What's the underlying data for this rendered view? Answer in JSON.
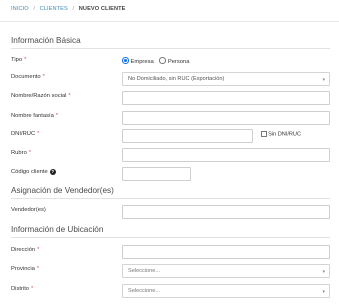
{
  "breadcrumb": {
    "items": [
      "INICIO",
      "CLIENTES"
    ],
    "separator": "/",
    "current": "NUEVO CLIENTE"
  },
  "sections": {
    "basic": "Información Básica",
    "seller": "Asignación de Vendedor(es)",
    "location": "Información de Ubicación"
  },
  "fields": {
    "tipo": {
      "label": "Tipo",
      "options": [
        "Empresa",
        "Persona"
      ],
      "selected": "Empresa"
    },
    "documento": {
      "label": "Documento",
      "value": "No Domiciliado, sin RUC (Exportación)"
    },
    "nombre_razon": {
      "label": "Nombre/Razón social",
      "value": ""
    },
    "nombre_fantasia": {
      "label": "Nombre fantasía",
      "value": ""
    },
    "dni_ruc": {
      "label": "DNI/RUC",
      "value": "",
      "checkbox_label": "Sin DNI/RUC"
    },
    "rubro": {
      "label": "Rubro",
      "value": ""
    },
    "codigo_cliente": {
      "label": "Código cliente",
      "value": ""
    },
    "vendedores": {
      "label": "Vendedor(es)",
      "value": ""
    },
    "direccion": {
      "label": "Dirección",
      "value": ""
    },
    "provincia": {
      "label": "Provincia",
      "value": "Seleccione..."
    },
    "distrito": {
      "label": "Distrito",
      "value": "Seleccione..."
    }
  },
  "required_marker": "*",
  "icons": {
    "help": "question-circle",
    "caret": "caret-down"
  },
  "colors": {
    "link": "#3c8dbc",
    "required": "#d9534f",
    "radio_checked": "#1a73e8"
  }
}
